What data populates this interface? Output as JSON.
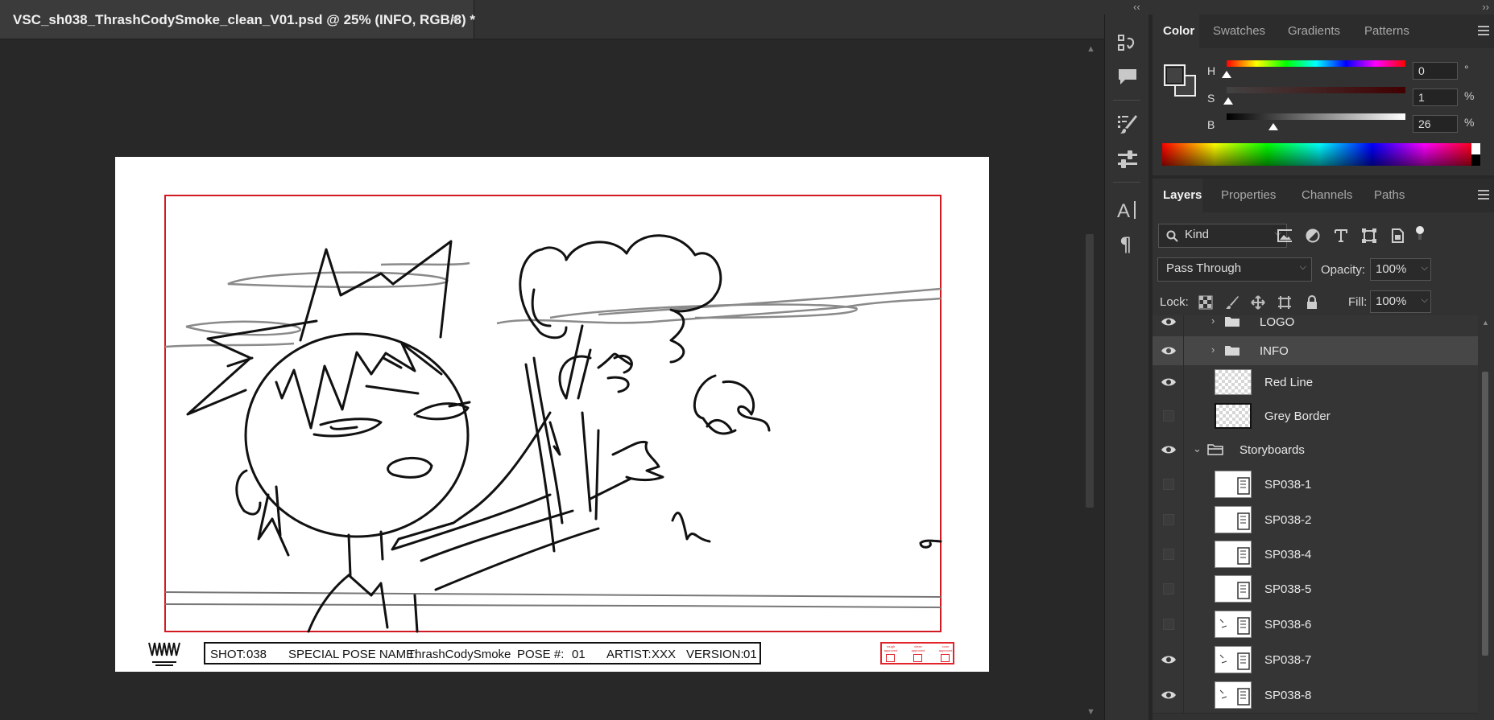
{
  "document": {
    "tab_title": "VSC_sh038_ThrashCodySmoke_clean_V01.psd @ 25% (INFO, RGB/8) *",
    "close_glyph": "×",
    "info_bar": {
      "shot_label": "SHOT:",
      "shot_value": "038",
      "pose_name_label": "SPECIAL POSE NAME:",
      "pose_name_value": "ThrashCodySmoke",
      "pose_num_label": "POSE #:",
      "pose_num_value": "01",
      "artist_label": "ARTIST:",
      "artist_value": "XXX",
      "version_label": "VERSION:",
      "version_value": "01"
    },
    "approvals": [
      "rough approved",
      "clean approved",
      "color approved"
    ],
    "logo_text": [
      "VAMPIRE",
      "SURF CLUB"
    ]
  },
  "panel_collapse": {
    "left": "‹‹",
    "right": "››"
  },
  "color_panel": {
    "tabs": [
      "Color",
      "Swatches",
      "Gradients",
      "Patterns"
    ],
    "active_tab": "Color",
    "h": {
      "label": "H",
      "value": "0",
      "unit": "°"
    },
    "s": {
      "label": "S",
      "value": "1",
      "unit": "%"
    },
    "b": {
      "label": "B",
      "value": "26",
      "unit": "%"
    },
    "fg_color": "#424242",
    "bg_color": "#424242"
  },
  "layers_panel": {
    "tabs": [
      "Layers",
      "Properties",
      "Channels",
      "Paths"
    ],
    "active_tab": "Layers",
    "filter_kind": "Kind",
    "blend_mode": "Pass Through",
    "opacity_label": "Opacity:",
    "opacity_value": "100%",
    "lock_label": "Lock:",
    "fill_label": "Fill:",
    "fill_value": "100%",
    "layers": [
      {
        "name": "LOGO",
        "type": "group",
        "visible": true,
        "selected": false,
        "indent": 1
      },
      {
        "name": "INFO",
        "type": "group",
        "visible": true,
        "selected": true,
        "indent": 1
      },
      {
        "name": "Red Line",
        "type": "layer",
        "visible": true,
        "selected": false
      },
      {
        "name": "Grey Border",
        "type": "layer",
        "visible": false,
        "selected": false
      },
      {
        "name": "Storyboards",
        "type": "group-open",
        "visible": true,
        "selected": false,
        "indent": 0
      },
      {
        "name": "SP038-1",
        "type": "layer",
        "visible": false,
        "selected": false
      },
      {
        "name": "SP038-2",
        "type": "layer",
        "visible": false,
        "selected": false
      },
      {
        "name": "SP038-4",
        "type": "layer",
        "visible": false,
        "selected": false
      },
      {
        "name": "SP038-5",
        "type": "layer",
        "visible": false,
        "selected": false
      },
      {
        "name": "SP038-6",
        "type": "layer",
        "visible": false,
        "selected": false
      },
      {
        "name": "SP038-7",
        "type": "layer",
        "visible": true,
        "selected": false
      },
      {
        "name": "SP038-8",
        "type": "layer",
        "visible": true,
        "selected": false
      }
    ]
  },
  "tool_icons": [
    "history-icon",
    "comment-icon",
    "brush-settings-icon",
    "adjustments-icon",
    "character-icon",
    "paragraph-icon"
  ]
}
